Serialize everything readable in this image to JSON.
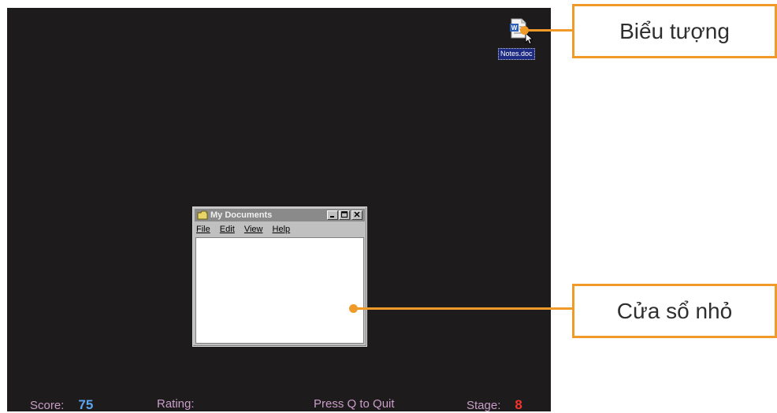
{
  "desktop": {
    "icon_label": "Notes.doc"
  },
  "window": {
    "title": "My Documents",
    "menu": [
      "File",
      "Edit",
      "View",
      "Help"
    ]
  },
  "statusbar": {
    "score_label": "Score:",
    "score_value": "75",
    "rating_label": "Rating:",
    "quit_hint": "Press Q to Quit",
    "stage_label": "Stage:",
    "stage_value": "8"
  },
  "callouts": {
    "icon_callout": "Biểu tượng",
    "window_callout": "Cửa sổ nhỏ"
  },
  "colors": {
    "screen_bg": "#1e1b1c",
    "callout_orange": "#f09a2a",
    "score_blue": "#5da4ee",
    "stage_red": "#f3342c",
    "status_text": "#c89ec8"
  }
}
